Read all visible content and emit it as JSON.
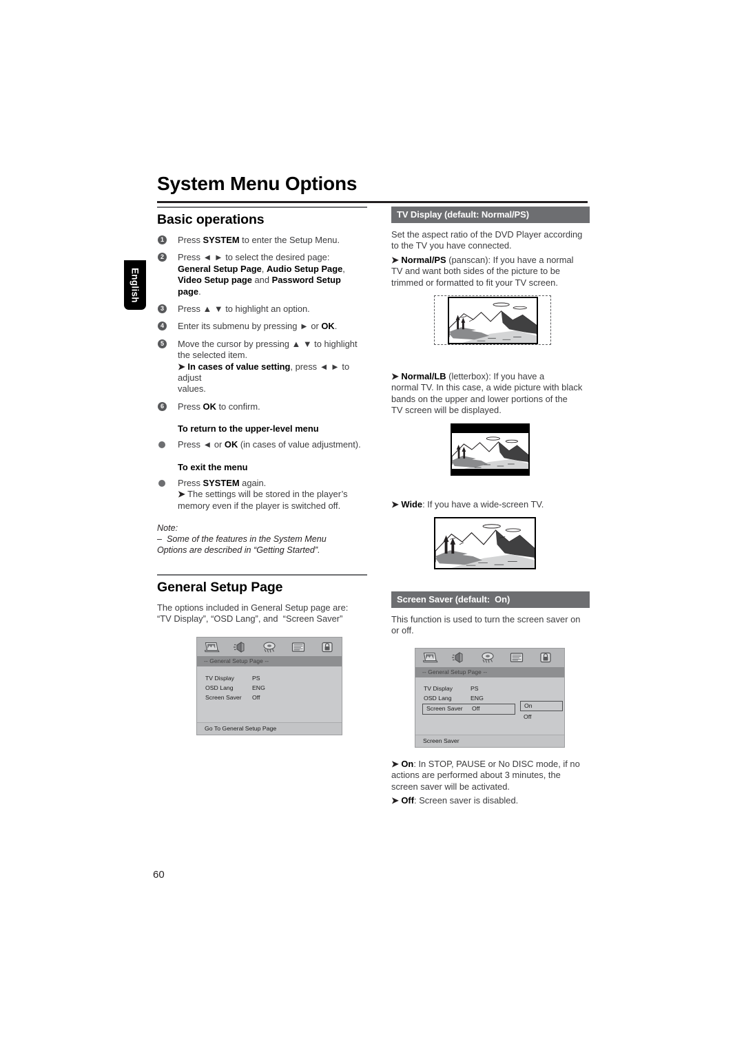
{
  "page": {
    "language_tab": "English",
    "title": "System Menu Options",
    "page_number": "60"
  },
  "left_column": {
    "section_title": "Basic operations",
    "steps": [
      {
        "num": "1",
        "html": "Press <b>SYSTEM</b> to enter the Setup Menu."
      },
      {
        "num": "2",
        "html": "Press &#9668; &#9658; to select the desired page:<br><b>General Setup Page</b>, <b>Audio Setup Page</b>,<br><b>Video Setup page</b> and <b>Password Setup</b><br><b>page</b>."
      },
      {
        "num": "3",
        "html": "Press &#9650; &#9660; to highlight an option."
      },
      {
        "num": "4",
        "html": "Enter its submenu by pressing &#9658; or <b>OK</b>."
      },
      {
        "num": "5",
        "html": "Move the cursor by pressing &#9650; &#9660; to highlight<br>the selected item.<br><span class=\"arrow\">&#10148;</span> <b>In cases of value setting</b>, press &#9668; &#9658; to adjust<br>values."
      },
      {
        "num": "6",
        "html": "Press <b>OK</b> to confirm."
      }
    ],
    "subhead_return": "To return to the upper-level menu",
    "bullet_return": "Press &#9668; or <b>OK</b> (in cases of value adjustment).",
    "subhead_exit": "To exit the menu",
    "bullet_exit": "Press <b>SYSTEM</b> again.<br><span class=\"arrow\">&#10148;</span> The settings will be stored in the player&#8217;s<br>memory even if the player is switched off.",
    "note_label": "Note:",
    "note_text": "&#8211;&nbsp; Some of the features in the System Menu<br>Options are described in &#8220;Getting Started&#8221;.",
    "general_setup_title": "General Setup Page",
    "general_setup_intro": "The options included in General Setup page are:<br>&#8220;TV Display&#8221;, &#8220;OSD Lang&#8221;, and &nbsp;&#8220;Screen Saver&#8221;"
  },
  "right_column": {
    "tv_display_header": "TV Display (default: Normal/PS)",
    "tv_display_intro": "Set the aspect ratio of the DVD Player according<br>to the TV you have connected.",
    "normal_ps": "<span class=\"arrow\">&#10148;</span> <b>Normal/PS</b> (panscan): If you have a normal<br>TV and want both sides of the picture to be<br>trimmed or formatted to fit your TV screen.",
    "normal_lb": "<span class=\"arrow\">&#10148;</span> <b>Normal/LB</b> (letterbox): If you have a<br>normal TV. In this case, a wide picture with black<br>bands on the upper and lower portions of the<br>TV screen will be displayed.",
    "wide": "<span class=\"arrow\">&#10148;</span> <b>Wide</b>: If you have a wide-screen TV.",
    "screen_saver_header": "Screen Saver (default: &nbsp;On)",
    "screen_saver_intro": "This function is used to turn the screen saver on<br>or off.",
    "screen_saver_on": "<span class=\"arrow\">&#10148;</span> <b>On</b>: In STOP, PAUSE or No DISC mode, if no<br>actions are performed about 3 minutes, the<br>screen saver will be activated.",
    "screen_saver_off": "<span class=\"arrow\">&#10148;</span> <b>Off</b>: Screen saver is disabled."
  },
  "osd_mockups": {
    "icons": [
      "tv-display-icon",
      "speaker-icon",
      "video-icon",
      "subtitle-icon",
      "lock-icon"
    ],
    "general_setup": {
      "title_bar": "-- General Setup Page --",
      "rows": [
        {
          "label": "TV Display",
          "value": "PS"
        },
        {
          "label": "OSD Lang",
          "value": "ENG"
        },
        {
          "label": "Screen Saver",
          "value": "Off"
        }
      ],
      "footer": "Go To General Setup Page"
    },
    "screen_saver": {
      "title_bar": "-- General Setup Page --",
      "rows": [
        {
          "label": "TV Display",
          "value": "PS",
          "selected": false
        },
        {
          "label": "OSD Lang",
          "value": "ENG",
          "selected": false
        },
        {
          "label": "Screen Saver",
          "value": "Off",
          "selected": true
        }
      ],
      "submenu": {
        "selected": "On",
        "other": "Off"
      },
      "footer": "Screen Saver"
    }
  },
  "colors": {
    "header_bar": "#6d6e71",
    "bullet": "#58595b",
    "text": "#3b3b3d",
    "osd_bg": "#c9cacc"
  }
}
